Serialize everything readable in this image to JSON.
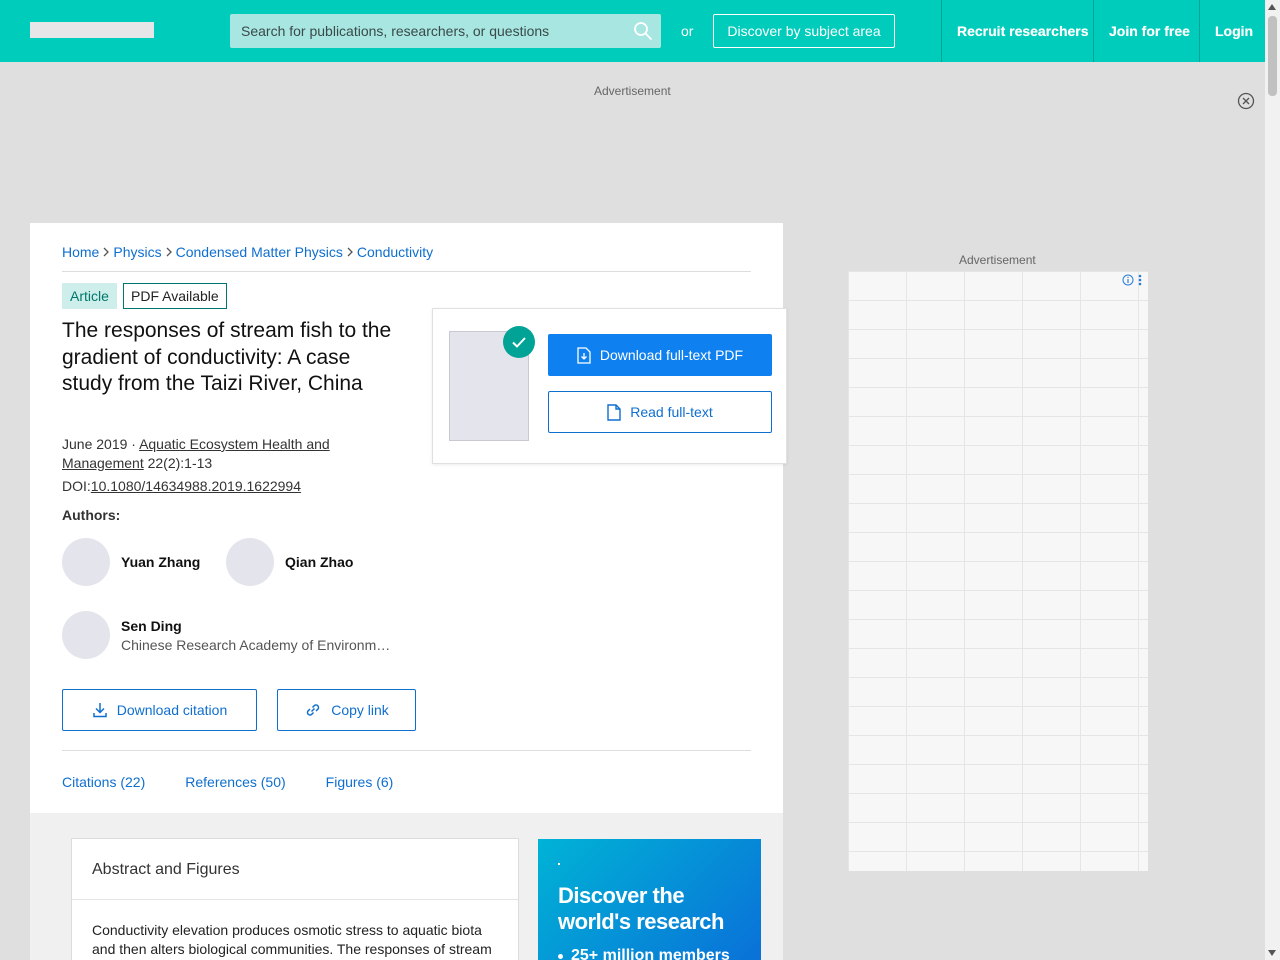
{
  "header": {
    "search_placeholder": "Search for publications, researchers, or questions",
    "or_text": "or",
    "discover_label": "Discover by subject area",
    "nav": [
      "Recruit researchers",
      "Join for free",
      "Login"
    ]
  },
  "ads": {
    "top_label": "Advertisement",
    "side_label": "Advertisement"
  },
  "breadcrumb": [
    "Home",
    "Physics",
    "Condensed Matter Physics",
    "Conductivity"
  ],
  "article": {
    "type_badge": "Article",
    "pdf_badge": "PDF Available",
    "title": "The responses of stream fish to the gradient of conductivity: A case study from the Taizi River, China",
    "date": "June 2019 · ",
    "journal": "Aquatic Ecosystem Health and Management",
    "volume": " 22(2):1-13",
    "doi_label": "DOI:",
    "doi": "10.1080/14634988.2019.1622994",
    "authors_label": "Authors:",
    "authors": [
      {
        "name": "Yuan Zhang",
        "affiliation": ""
      },
      {
        "name": "Qian Zhao",
        "affiliation": ""
      },
      {
        "name": "Sen Ding",
        "affiliation": "Chinese Research Academy of Environmental Sciences"
      }
    ]
  },
  "actions": {
    "download_pdf": "Download full-text PDF",
    "read_full_text": "Read full-text",
    "download_citation": "Download citation",
    "copy_link": "Copy link"
  },
  "tabs": [
    "Citations (22)",
    "References (50)",
    "Figures (6)"
  ],
  "abstract": {
    "heading": "Abstract and Figures",
    "text": "Conductivity elevation produces osmotic stress to aquatic biota and then alters biological communities. The responses of stream"
  },
  "promo": {
    "title": "Discover the world's research",
    "bullet": "25+ million members"
  },
  "colors": {
    "brand": "#00ccbb",
    "link": "#0f6fcf",
    "primary_button": "#0f80ef",
    "check": "#00a396"
  }
}
